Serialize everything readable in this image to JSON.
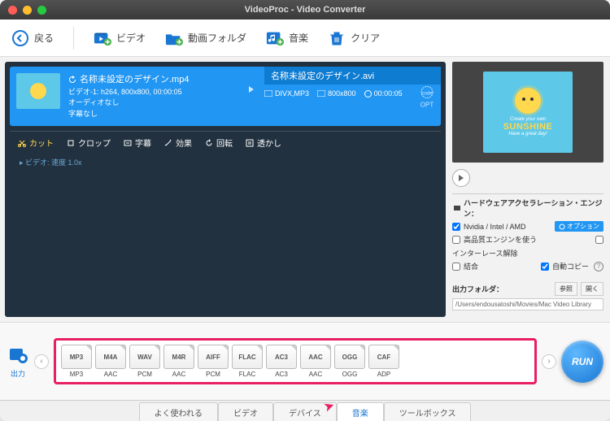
{
  "title": "VideoProc - Video Converter",
  "toolbar": {
    "back": "戻る",
    "video": "ビデオ",
    "folder": "動画フォルダ",
    "music": "音楽",
    "clear": "クリア"
  },
  "clip": {
    "filename": "名称未設定のデザイン.mp4",
    "info": "ビデオ-1: h264, 800x800, 00:00:05",
    "audio": "オーディオなし",
    "sub": "字幕なし",
    "out_name": "名称未設定のデザイン.avi",
    "codec": "DIVX,MP3",
    "res": "800x800",
    "dur": "00:00:05",
    "opt": "OPT"
  },
  "edit": {
    "cut": "カット",
    "crop": "クロップ",
    "sub": "字幕",
    "effect": "効果",
    "rotate": "回転",
    "trans": "透かし"
  },
  "speed": "▸ ビデオ: 速度 1.0x",
  "preview": {
    "line1": "Create your own",
    "line2": "SUNSHINE",
    "line3": "Have a great day!"
  },
  "hw": {
    "header": "ハードウェアアクセラレーション・エンジン：",
    "nvidia": "Nvidia / Intel / AMD",
    "option": "オプション",
    "hq": "高品質エンジンを使う",
    "deint": "インターレース解除",
    "join": "結合",
    "autocopy": "自動コピー"
  },
  "folder": {
    "label": "出力フォルダ：",
    "browse": "参照",
    "open": "開く",
    "path": "/Users/endousatoshi/Movies/Mac Video Library"
  },
  "output_label": "出力",
  "formats": [
    {
      "top": "MP3",
      "bot": "MP3"
    },
    {
      "top": "M4A",
      "bot": "AAC"
    },
    {
      "top": "WAV",
      "bot": "PCM"
    },
    {
      "top": "M4R",
      "bot": "AAC"
    },
    {
      "top": "AIFF",
      "bot": "PCM"
    },
    {
      "top": "FLAC",
      "bot": "FLAC"
    },
    {
      "top": "AC3",
      "bot": "AC3"
    },
    {
      "top": "AAC",
      "bot": "AAC"
    },
    {
      "top": "OGG",
      "bot": "OGG"
    },
    {
      "top": "CAF",
      "bot": "ADP"
    }
  ],
  "run": "RUN",
  "tabs": {
    "popular": "よく使われる",
    "video": "ビデオ",
    "device": "デバイス",
    "music": "音楽",
    "toolbox": "ツールボックス"
  }
}
